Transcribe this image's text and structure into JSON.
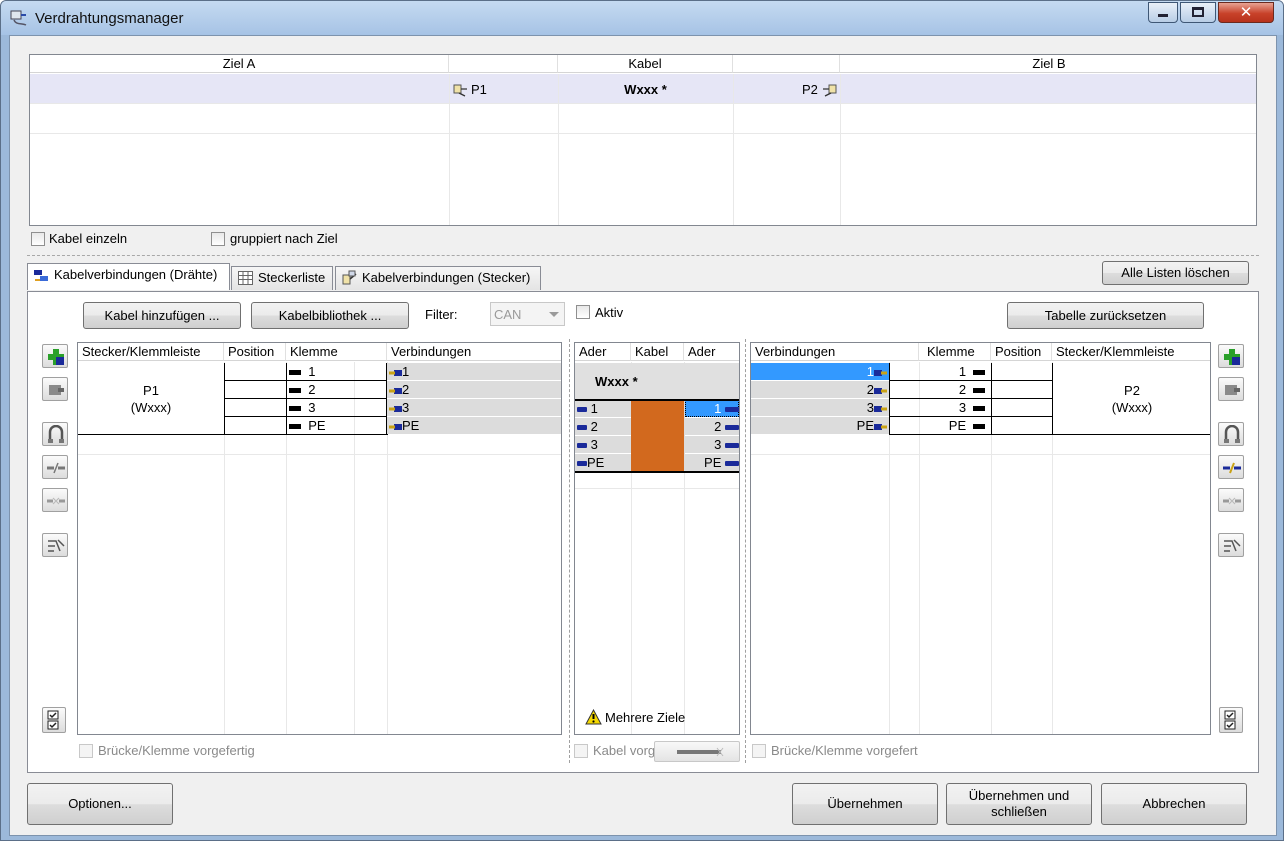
{
  "window": {
    "title": "Verdrahtungsmanager",
    "controls": [
      "_",
      "☐",
      "✕"
    ]
  },
  "top_grid": {
    "headers": [
      "Ziel A",
      "Kabel",
      "Ziel B"
    ],
    "row": {
      "p1": "P1",
      "cable": "Wxxx *",
      "p2": "P2"
    }
  },
  "options_row": {
    "kabel_einzeln": "Kabel einzeln",
    "gruppiert": "gruppiert nach Ziel"
  },
  "tabs": [
    {
      "label": "Kabelverbindungen (Drähte)",
      "active": true,
      "icon": "cable-wires-icon"
    },
    {
      "label": "Steckerliste",
      "active": false,
      "icon": "table-icon"
    },
    {
      "label": "Kabelverbindungen (Stecker)",
      "active": false,
      "icon": "plug-connections-icon"
    }
  ],
  "toolbar": {
    "clear_all": "Alle Listen löschen",
    "add_cable": "Kabel hinzufügen ...",
    "cable_library": "Kabelbibliothek ...",
    "filter_label": "Filter:",
    "filter_value": "CAN",
    "active_label": "Aktiv",
    "reset_table": "Tabelle zurücksetzen"
  },
  "left_table": {
    "headers": [
      "Stecker/Klemmleiste",
      "Position",
      "Klemme",
      "Verbindungen"
    ],
    "connector_name": "P1",
    "connector_cable": "(Wxxx)",
    "rows": [
      {
        "klemme": "1",
        "verbindung": "1"
      },
      {
        "klemme": "2",
        "verbindung": "2"
      },
      {
        "klemme": "3",
        "verbindung": "3"
      },
      {
        "klemme": "PE",
        "verbindung": "PE"
      }
    ],
    "footer_checkbox": "Brücke/Klemme vorgefertig"
  },
  "middle_table": {
    "headers": [
      "Ader",
      "Kabel",
      "Ader"
    ],
    "cable_name": "Wxxx *",
    "rows": [
      {
        "left": "1",
        "right": "1"
      },
      {
        "left": "2",
        "right": "2"
      },
      {
        "left": "3",
        "right": "3"
      },
      {
        "left": "PE",
        "right": "PE"
      }
    ],
    "cable_color": "#d2691e",
    "warning": "Mehrere Ziele",
    "footer_checkbox": "Kabel vorg"
  },
  "right_table": {
    "headers": [
      "Verbindungen",
      "Klemme",
      "Position",
      "Stecker/Klemmleiste"
    ],
    "connector_name": "P2",
    "connector_cable": "(Wxxx)",
    "rows": [
      {
        "verbindung": "1",
        "klemme": "1"
      },
      {
        "verbindung": "2",
        "klemme": "2"
      },
      {
        "verbindung": "3",
        "klemme": "3"
      },
      {
        "verbindung": "PE",
        "klemme": "PE"
      }
    ],
    "footer_checkbox": "Brücke/Klemme vorgefert"
  },
  "bottom": {
    "options": "Optionen...",
    "apply": "Übernehmen",
    "apply_close_1": "Übernehmen und",
    "apply_close_2": "schließen",
    "cancel": "Abbrechen"
  },
  "colors": {
    "selection": "#3399ff",
    "row_highlight": "#e6e6f6",
    "pin": "#1a2a9a",
    "cable": "#d2691e"
  }
}
